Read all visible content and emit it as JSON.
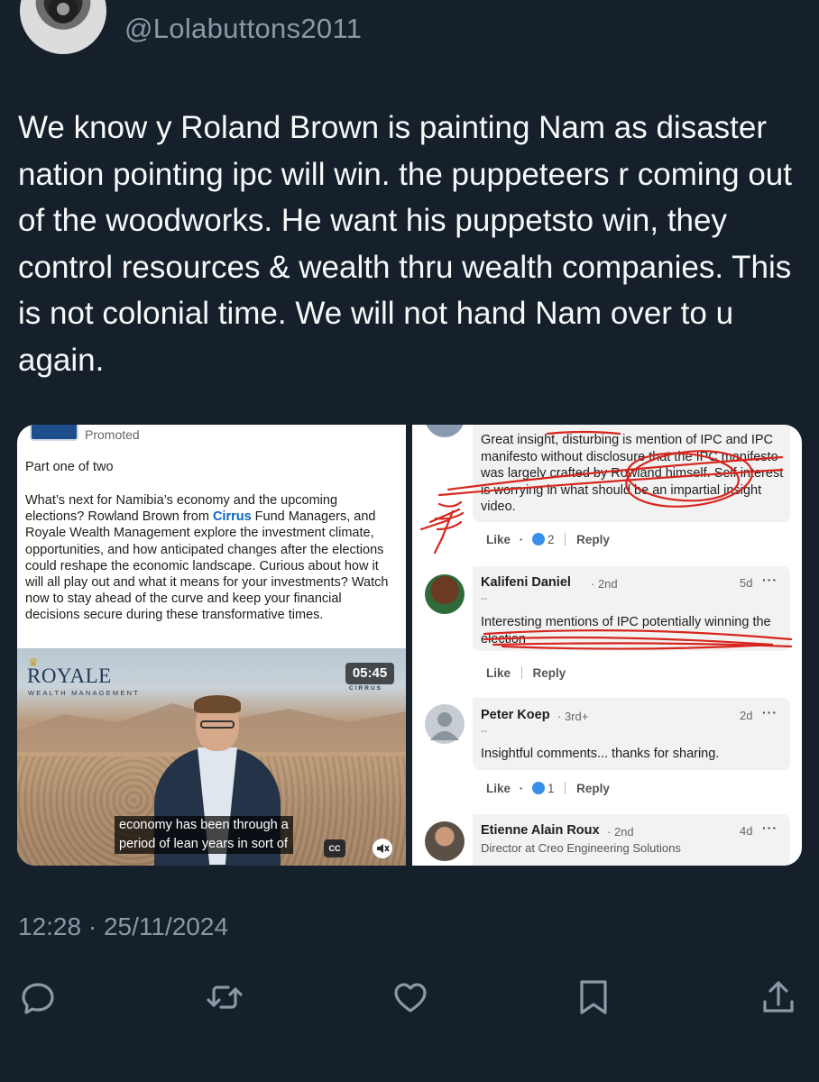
{
  "tweet": {
    "handle": "@Lolabuttons2011",
    "text": "We know y Roland Brown is painting Nam as disaster nation pointing ipc will win. the puppeteers r coming out of the woodworks. He want his puppetsto win, they control resources & wealth thru wealth companies. This is not colonial time. We will not hand Nam over to u again.",
    "timestamp": "12:28 · 25/11/2024"
  },
  "left_image": {
    "promoted": "Promoted",
    "part_label": "Part one of two",
    "body_before": "What’s next for Namibia’s economy and the upcoming elections? Rowland Brown from ",
    "body_link": "Cirrus",
    "body_after": " Fund Managers, and Royale Wealth Management explore the investment climate, opportunities, and how anticipated changes after the elections could reshape the economic landscape. Curious about how it will all play out and what it means for your investments? Watch now to stay ahead of the curve and keep your financial decisions secure during these transformative times.",
    "video": {
      "brand": "ROYALE",
      "brand_sub": "WEALTH MANAGEMENT",
      "partner": "CIRRUS",
      "duration": "05:45",
      "subtitle_line1": "economy has been through a",
      "subtitle_line2": "period of lean years in sort of",
      "cc_label": "CC"
    }
  },
  "right_image": {
    "comments": [
      {
        "text": "Great insight, disturbing is mention of IPC and IPC manifesto without disclosure that the IPC manifesto was largely crafted by Rowland himself. Self interest is worrying in what should be an impartial insight video.",
        "like": "Like",
        "reactions": "2",
        "reply": "Reply"
      },
      {
        "name": "Kalifeni Daniel",
        "degree": "· 2nd",
        "age": "5d",
        "dashes": "--",
        "text": "Interesting mentions of IPC potentially winning the election",
        "like": "Like",
        "reply": "Reply"
      },
      {
        "name": "Peter Koep",
        "degree": "· 3rd+",
        "age": "2d",
        "dashes": "--",
        "text": "Insightful comments... thanks for sharing.",
        "like": "Like",
        "reactions": "1",
        "reply": "Reply"
      },
      {
        "name": "Etienne Alain Roux",
        "degree": "· 2nd",
        "age": "4d",
        "headline": "Director at Creo Engineering Solutions"
      }
    ],
    "more": "···",
    "dot": "·"
  },
  "colors": {
    "background": "#15202b",
    "text": "#f7f9f9",
    "muted": "#8b98a5",
    "link": "#0a66c2",
    "annotation_red": "#d7261e"
  },
  "icons": [
    "reply-icon",
    "retweet-icon",
    "like-icon",
    "bookmark-icon",
    "share-icon"
  ]
}
